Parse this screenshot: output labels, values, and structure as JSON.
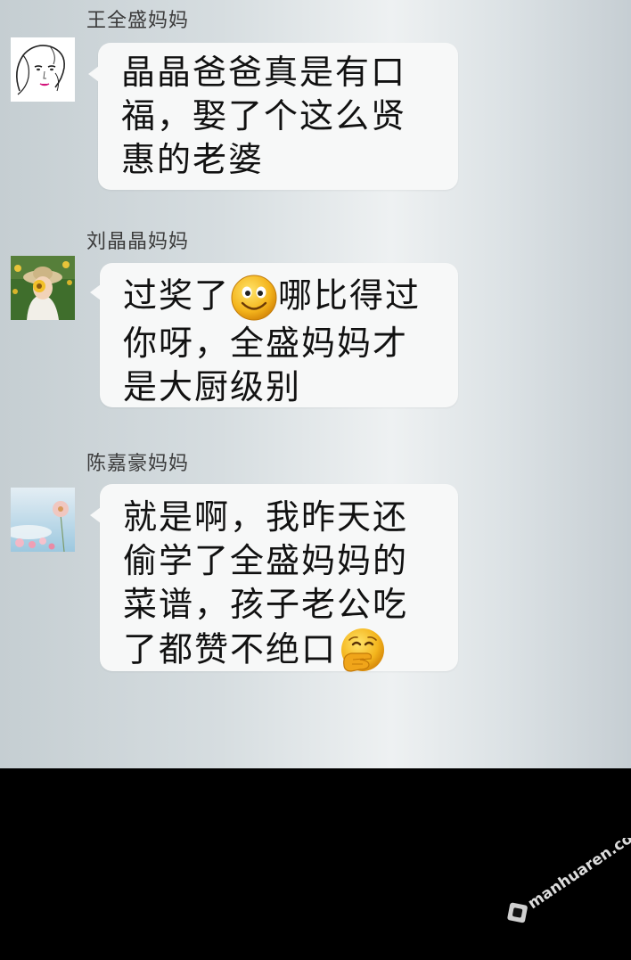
{
  "messages": [
    {
      "sender": "王全盛妈妈",
      "lines": [
        "晶晶爸爸真是有口",
        "福，娶了个这么贤",
        "惠的老婆"
      ]
    },
    {
      "sender": "刘晶晶妈妈",
      "lines_pre": "过奖了",
      "line1_post": "哪比得过",
      "lines_rest": [
        "你呀，全盛妈妈才",
        "是大厨级别"
      ],
      "emoji": "smile-emoji"
    },
    {
      "sender": "陈嘉豪妈妈",
      "lines": [
        "就是啊，我昨天还",
        "偷学了全盛妈妈的",
        "菜谱，孩子老公吃"
      ],
      "last_line": "了都赞不绝口",
      "emoji": "face-with-hand-over-mouth-emoji"
    }
  ],
  "watermark": {
    "text": "manhuaren.com"
  },
  "colors": {
    "bubble": "#f7f8f8",
    "bottom_bar": "#000000"
  }
}
